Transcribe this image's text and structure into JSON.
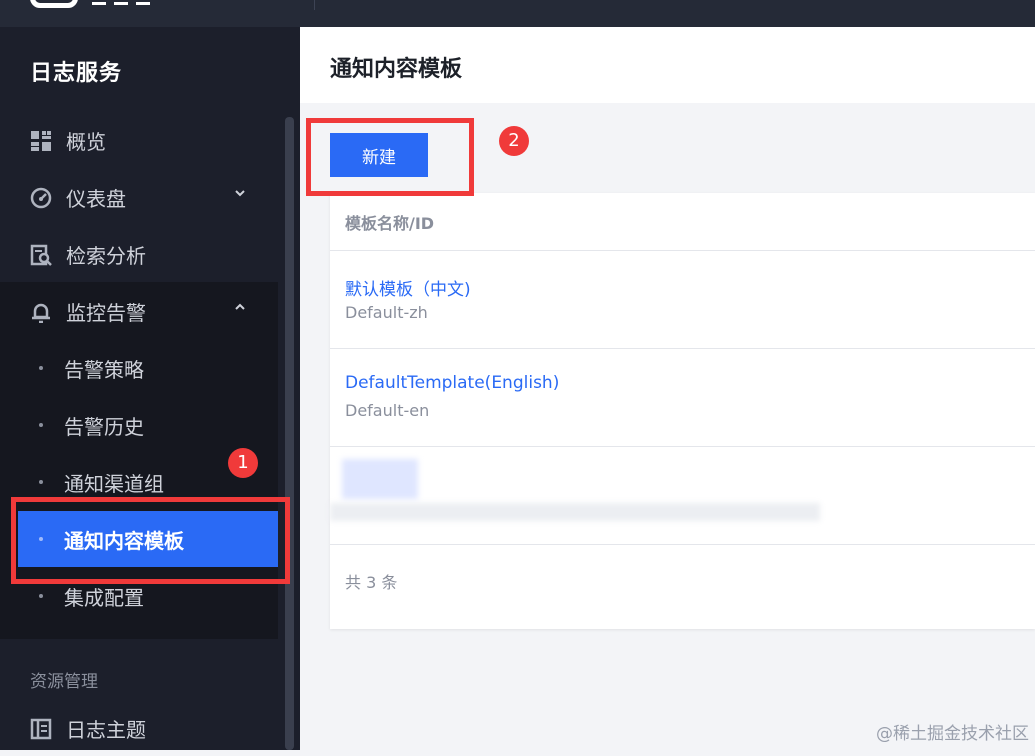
{
  "sidebar": {
    "title": "日志服务",
    "items": [
      {
        "label": "概览",
        "icon": "grid-icon"
      },
      {
        "label": "仪表盘",
        "icon": "dashboard-gauge-icon"
      },
      {
        "label": "检索分析",
        "icon": "search-document-icon"
      },
      {
        "label": "监控告警",
        "icon": "bell-icon"
      }
    ],
    "subitems": [
      {
        "label": "告警策略"
      },
      {
        "label": "告警历史"
      },
      {
        "label": "通知渠道组"
      },
      {
        "label": "通知内容模板",
        "active": true
      },
      {
        "label": "集成配置"
      }
    ],
    "section_label": "资源管理",
    "bottom_item": {
      "label": "日志主题",
      "icon": "book-icon"
    }
  },
  "main": {
    "title": "通知内容模板",
    "new_button": "新建",
    "table": {
      "column_header": "模板名称/ID",
      "rows": [
        {
          "name": "默认模板（中文)",
          "id": "Default-zh"
        },
        {
          "name": "DefaultTemplate(English)",
          "id": "Default-en"
        }
      ],
      "total_text": "共 3 条"
    }
  },
  "annotations": {
    "badge_1": "1",
    "badge_2": "2",
    "color": "#f03a3a"
  },
  "watermark": "@稀土掘金技术社区",
  "colors": {
    "accent": "#2a6af5",
    "sidebar_bg": "#1c1f2b",
    "topbar_bg": "#252a37"
  }
}
